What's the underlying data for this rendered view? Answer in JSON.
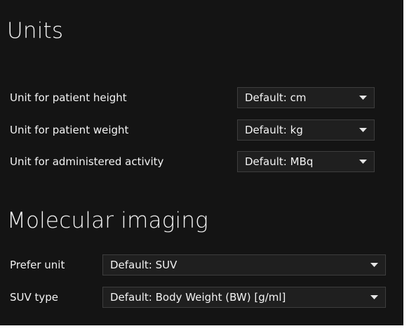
{
  "units": {
    "title": "Units",
    "rows": [
      {
        "label": "Unit for patient height",
        "value": "Default: cm"
      },
      {
        "label": "Unit for patient weight",
        "value": "Default: kg"
      },
      {
        "label": "Unit for administered activity",
        "value": "Default: MBq"
      }
    ]
  },
  "molecular_imaging": {
    "title": "Molecular imaging",
    "rows": [
      {
        "label": "Prefer unit",
        "value": "Default: SUV"
      },
      {
        "label": "SUV type",
        "value": "Default: Body Weight (BW) [g/ml]"
      }
    ]
  },
  "icons": {
    "dropdown": "chevron-down-icon"
  },
  "colors": {
    "background": "#141414",
    "text": "#f3f3f3",
    "field_border": "#3d3d3d",
    "field_background": "#1f1f1f"
  }
}
